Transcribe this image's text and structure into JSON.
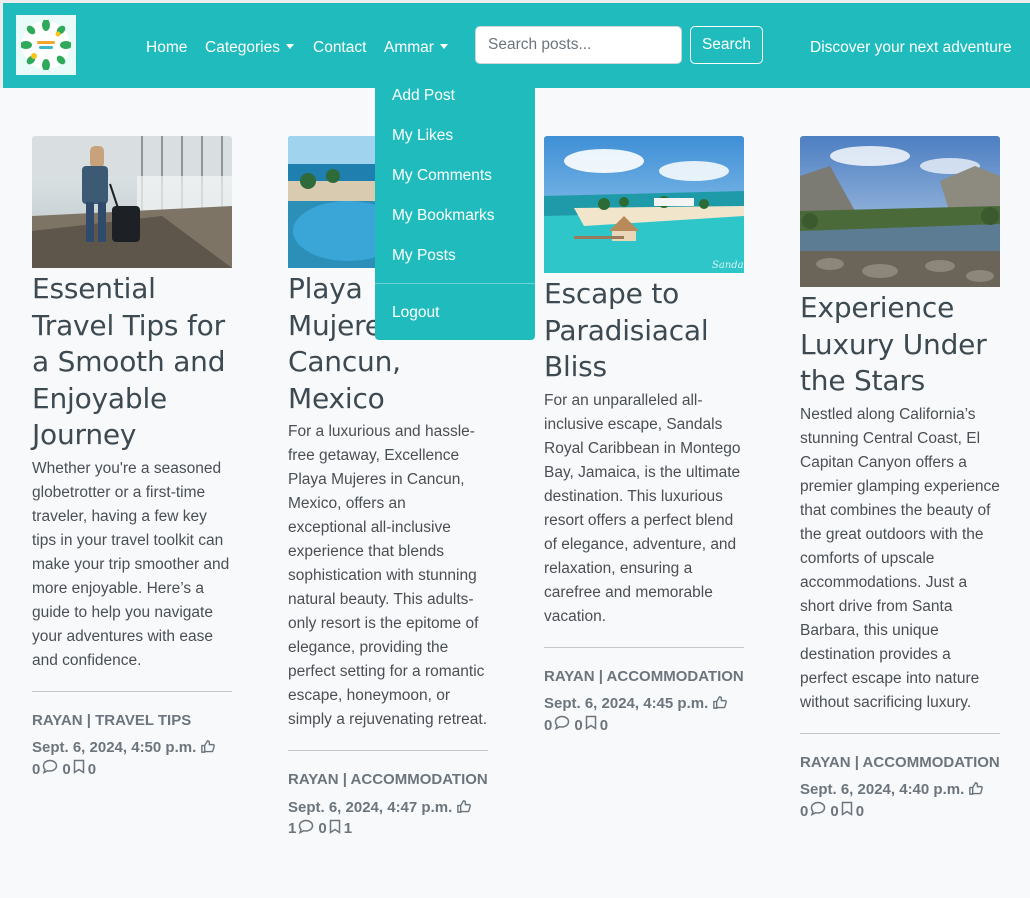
{
  "nav": {
    "links": {
      "home": "Home",
      "categories": "Categories",
      "contact": "Contact",
      "user": "Ammar"
    },
    "search_placeholder": "Search posts...",
    "search_button": "Search",
    "tagline": "Discover your next adventure"
  },
  "dropdown": {
    "items": [
      "Add Post",
      "My Likes",
      "My Comments",
      "My Bookmarks",
      "My Posts"
    ],
    "logout": "Logout"
  },
  "posts": [
    {
      "title": "Essential Travel Tips for a Smooth and Enjoyable Journey",
      "excerpt": "Whether you're a seasoned globetrotter or a first-time traveler, having a few key tips in your travel toolkit can make your trip smoother and more enjoyable. Here’s a guide to help you navigate your adventures with ease and confidence.",
      "meta": "RAYAN | TRAVEL TIPS",
      "date": "Sept. 6, 2024, 4:50 p.m.",
      "likes": "0",
      "comments": "0",
      "bookmarks": "0"
    },
    {
      "title": "Playa Mujeres, Cancun, Mexico",
      "excerpt": "For a luxurious and hassle-free getaway, Excellence Playa Mujeres in Cancun, Mexico, offers an exceptional all-inclusive experience that blends sophistication with stunning natural beauty. This adults-only resort is the epitome of elegance, providing the perfect setting for a romantic escape, honeymoon, or simply a rejuvenating retreat.",
      "meta": "RAYAN | ACCOMMODATION",
      "date": "Sept. 6, 2024, 4:47 p.m.",
      "likes": "1",
      "comments": "0",
      "bookmarks": "1"
    },
    {
      "title": "Escape to Paradisiacal Bliss",
      "excerpt": "For an unparalleled all-inclusive escape, Sandals Royal Caribbean in Montego Bay, Jamaica, is the ultimate destination. This luxurious resort offers a perfect blend of elegance, adventure, and relaxation, ensuring a carefree and memorable vacation.",
      "meta": "RAYAN | ACCOMMODATION",
      "date": "Sept. 6, 2024, 4:45 p.m.",
      "likes": "0",
      "comments": "0",
      "bookmarks": "0",
      "watermark": "Sandals"
    },
    {
      "title": "Experience Luxury Under the Stars",
      "excerpt": "Nestled along California’s stunning Central Coast, El Capitan Canyon offers a premier glamping experience that combines the beauty of the great outdoors with the comforts of upscale accommodations. Just a short drive from Santa Barbara, this unique destination provides a perfect escape into nature without sacrificing luxury.",
      "meta": "RAYAN | ACCOMMODATION",
      "date": "Sept. 6, 2024, 4:40 p.m.",
      "likes": "0",
      "comments": "0",
      "bookmarks": "0"
    }
  ],
  "colors": {
    "navbar": "#20bcbd",
    "page_bg": "#f8f9fa",
    "title": "#3d4a52",
    "muted": "#6c757d"
  }
}
